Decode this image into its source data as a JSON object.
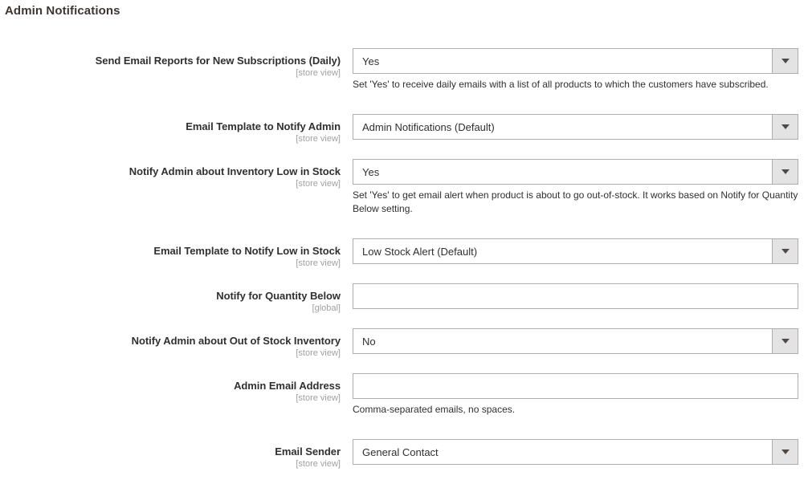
{
  "page": {
    "title": "Admin Notifications"
  },
  "scopes": {
    "store_view": "[store view]",
    "global": "[global]"
  },
  "fields": [
    {
      "id": "send-email-reports-new-subscriptions",
      "label": "Send Email Reports for New Subscriptions (Daily)",
      "scope": "[store view]",
      "control": "select",
      "value": "Yes",
      "help": "Set 'Yes' to receive daily emails with a list of all products to which the customers have subscribed."
    },
    {
      "id": "email-template-notify-admin",
      "label": "Email Template to Notify Admin",
      "scope": "[store view]",
      "control": "select",
      "value": "Admin Notifications (Default)",
      "help": ""
    },
    {
      "id": "notify-admin-inventory-low-in-stock",
      "label": "Notify Admin about Inventory Low in Stock",
      "scope": "[store view]",
      "control": "select",
      "value": "Yes",
      "help": "Set 'Yes' to get email alert when product is about to go out-of-stock. It works based on Notify for Quantity Below setting."
    },
    {
      "id": "email-template-notify-low-in-stock",
      "label": "Email Template to Notify Low in Stock",
      "scope": "[store view]",
      "control": "select",
      "value": "Low Stock Alert (Default)",
      "help": ""
    },
    {
      "id": "notify-for-quantity-below",
      "label": "Notify for Quantity Below",
      "scope": "[global]",
      "control": "text",
      "value": "",
      "placeholder": "",
      "help": ""
    },
    {
      "id": "notify-admin-out-of-stock-inventory",
      "label": "Notify Admin about Out of Stock Inventory",
      "scope": "[store view]",
      "control": "select",
      "value": "No",
      "help": ""
    },
    {
      "id": "admin-email-address",
      "label": "Admin Email Address",
      "scope": "[store view]",
      "control": "text",
      "value": "",
      "placeholder": "",
      "help": "Comma-separated emails, no spaces."
    },
    {
      "id": "email-sender",
      "label": "Email Sender",
      "scope": "[store view]",
      "control": "select",
      "value": "General Contact",
      "help": ""
    }
  ],
  "icons": {
    "dropdown_arrow": "chevron-down-icon"
  },
  "colors": {
    "page_background": "#ffffff",
    "label_text": "#303030",
    "scope_text": "#a1a1a1",
    "field_border": "#adadad",
    "dropdown_button_background": "#e3e3e3",
    "title_text": "#41362f"
  }
}
